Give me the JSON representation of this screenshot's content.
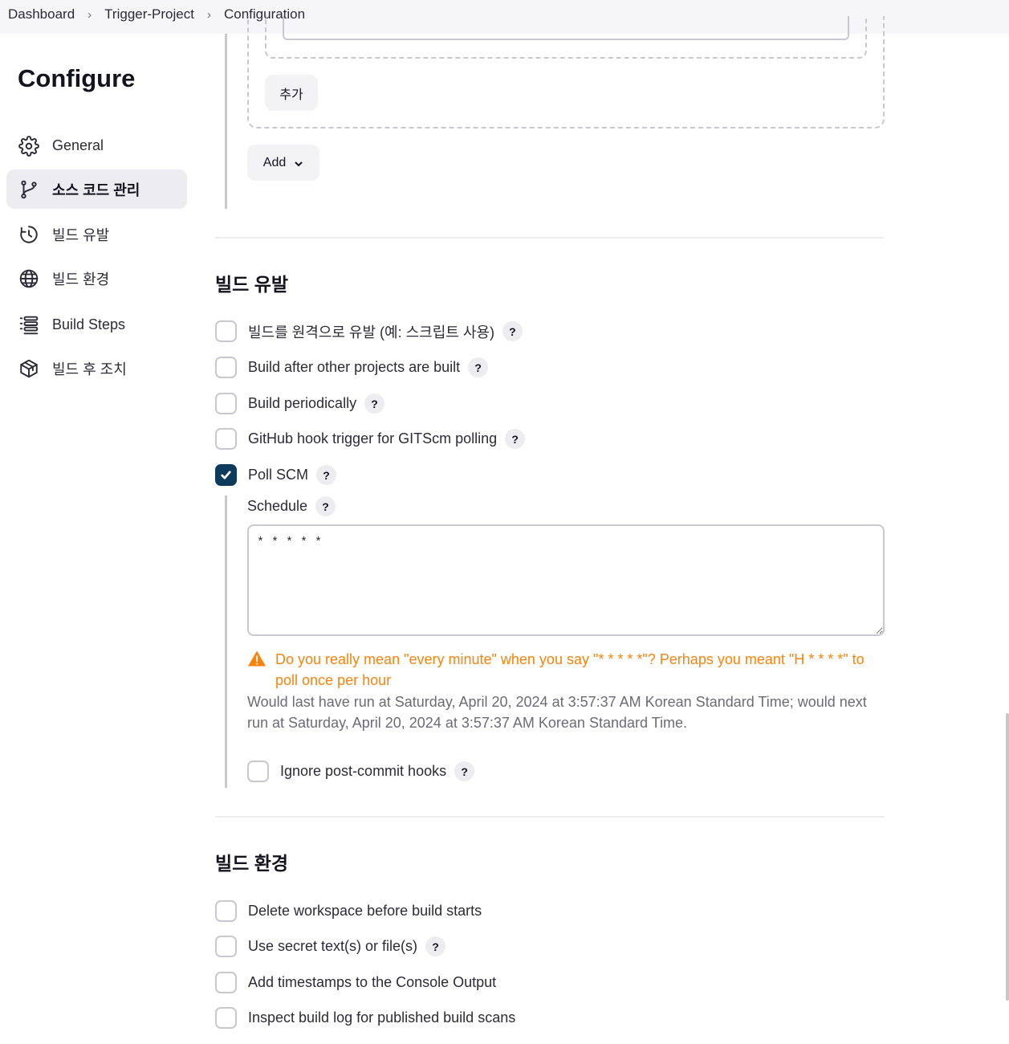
{
  "breadcrumb": {
    "items": [
      "Dashboard",
      "Trigger-Project",
      "Configuration"
    ]
  },
  "sidebar": {
    "title": "Configure",
    "items": [
      {
        "label": "General",
        "icon": "gear-icon",
        "active": false
      },
      {
        "label": "소스 코드 관리",
        "icon": "branch-icon",
        "active": true
      },
      {
        "label": "빌드 유발",
        "icon": "clock-icon",
        "active": false
      },
      {
        "label": "빌드 환경",
        "icon": "globe-icon",
        "active": false
      },
      {
        "label": "Build Steps",
        "icon": "list-icon",
        "active": false
      },
      {
        "label": "빌드 후 조치",
        "icon": "package-icon",
        "active": false
      }
    ]
  },
  "scm": {
    "add_inner_label": "추가",
    "add_label": "Add"
  },
  "triggers": {
    "title": "빌드 유발",
    "options": [
      {
        "label": "빌드를 원격으로 유발 (예: 스크립트 사용)",
        "checked": false,
        "help": "?"
      },
      {
        "label": "Build after other projects are built",
        "checked": false,
        "help": "?"
      },
      {
        "label": "Build periodically",
        "checked": false,
        "help": "?"
      },
      {
        "label": "GitHub hook trigger for GITScm polling",
        "checked": false,
        "help": "?"
      },
      {
        "label": "Poll SCM",
        "checked": true,
        "help": "?"
      }
    ],
    "schedule": {
      "label": "Schedule",
      "help": "?",
      "value": "* * * * *",
      "warning": "Do you really mean \"every minute\" when you say \"* * * * *\"? Perhaps you meant \"H * * * *\" to poll once per hour",
      "info": "Would last have run at Saturday, April 20, 2024 at 3:57:37 AM Korean Standard Time; would next run at Saturday, April 20, 2024 at 3:57:37 AM Korean Standard Time."
    },
    "ignore_hooks": {
      "label": "Ignore post-commit hooks",
      "checked": false,
      "help": "?"
    }
  },
  "environment": {
    "title": "빌드 환경",
    "options": [
      {
        "label": "Delete workspace before build starts",
        "checked": false
      },
      {
        "label": "Use secret text(s) or file(s)",
        "checked": false,
        "help": "?"
      },
      {
        "label": "Add timestamps to the Console Output",
        "checked": false
      },
      {
        "label": "Inspect build log for published build scans",
        "checked": false
      }
    ]
  },
  "colors": {
    "accent": "#0e3a5c",
    "warning": "#fe820a",
    "muted": "#6b6b78",
    "border": "#c8c8d0"
  }
}
